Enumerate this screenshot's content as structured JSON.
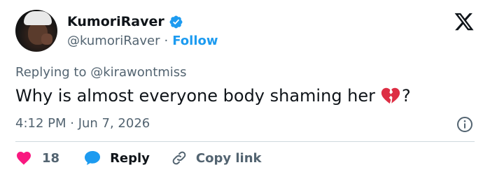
{
  "author": {
    "name": "KumoriRaver",
    "handle": "@kumoriRaver",
    "separator": "·",
    "follow_label": "Follow"
  },
  "tweet": {
    "replying_to": "Replying to @kirawontmiss",
    "text": "Why is almost everyone body shaming her",
    "text_suffix": "?",
    "emoji": "broken-heart-emoji",
    "timestamp": "4:12 PM · Jun 7, 2026"
  },
  "actions": {
    "like_count": "18",
    "reply_label": "Reply",
    "copy_label": "Copy link"
  },
  "colors": {
    "accent": "#1d9bf0",
    "like": "#f91880",
    "text": "#0f1419",
    "muted": "#536471"
  },
  "icons": [
    "verified-badge-icon",
    "x-logo-icon",
    "info-icon",
    "heart-icon",
    "speech-bubble-icon",
    "link-icon"
  ]
}
